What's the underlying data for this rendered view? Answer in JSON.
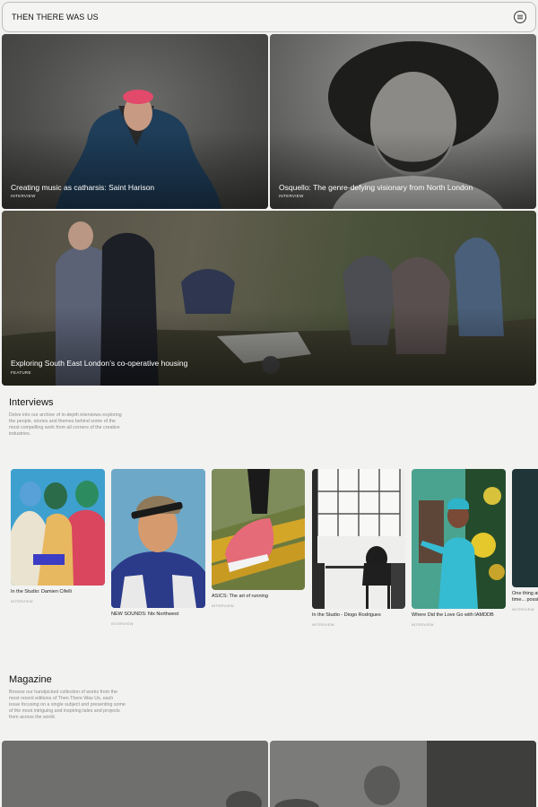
{
  "header": {
    "logo": "THEN THERE WAS US",
    "menu_icon": "menu-icon"
  },
  "hero": [
    {
      "title": "Creating music as catharsis: Saint Harison",
      "tag": "INTERVIEW"
    },
    {
      "title": "Osquello: The genre-defying visionary from North London",
      "tag": "INTERVIEW"
    },
    {
      "title": "Exploring South East London’s co-operative housing",
      "tag": "FEATURE"
    }
  ],
  "interviews": {
    "heading": "Interviews",
    "description": "Delve into our archive of in-depth interviews exploring the people, stories and themes behind some of the most compelling work from all corners of the creative industries.",
    "cards": [
      {
        "title": "In the Studio: Damien Cifelli",
        "tag": "INTERVIEW"
      },
      {
        "title": "NEW SOUNDS: Nix Northwest",
        "tag": "INTERVIEW"
      },
      {
        "title": "ASICS: The art of running",
        "tag": "INTERVIEW"
      },
      {
        "title": "In the Studio - Diogo Rodrigues",
        "tag": "INTERVIEW"
      },
      {
        "title": "Where Did the Love Go with IAMDDB",
        "tag": "INTERVIEW"
      },
      {
        "title": "One thing at a time... possible",
        "tag": "INTERVIEW"
      }
    ]
  },
  "magazine": {
    "heading": "Magazine",
    "description": "Browse our handpicked collection of works from the most recent editions of Then There Was Us, each issue focusing on a single subject and presenting some of the most intriguing and inspiring tales and projects from across the world."
  }
}
